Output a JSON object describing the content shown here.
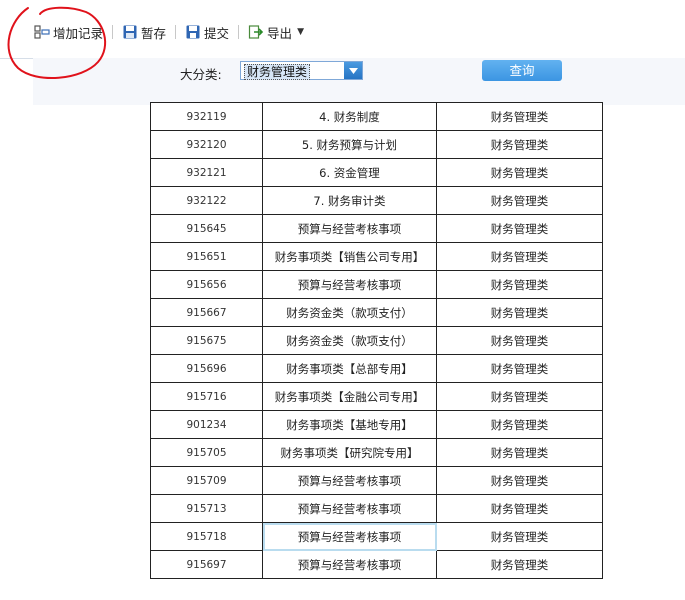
{
  "toolbar": {
    "add_record": "增加记录",
    "save_draft": "暂存",
    "submit": "提交",
    "export": "导出"
  },
  "filter": {
    "label": "大分类:",
    "category_value": "财务管理类",
    "query_button": "查询"
  },
  "table": {
    "rows": [
      {
        "code": "932119",
        "name": "4. 财务制度",
        "category": "财务管理类"
      },
      {
        "code": "932120",
        "name": "5. 财务预算与计划",
        "category": "财务管理类"
      },
      {
        "code": "932121",
        "name": "6. 资金管理",
        "category": "财务管理类"
      },
      {
        "code": "932122",
        "name": "7. 财务审计类",
        "category": "财务管理类"
      },
      {
        "code": "915645",
        "name": "预算与经营考核事项",
        "category": "财务管理类"
      },
      {
        "code": "915651",
        "name": "财务事项类【销售公司专用】",
        "category": "财务管理类"
      },
      {
        "code": "915656",
        "name": "预算与经营考核事项",
        "category": "财务管理类"
      },
      {
        "code": "915667",
        "name": "财务资金类（款项支付）",
        "category": "财务管理类"
      },
      {
        "code": "915675",
        "name": "财务资金类（款项支付）",
        "category": "财务管理类"
      },
      {
        "code": "915696",
        "name": "财务事项类【总部专用】",
        "category": "财务管理类"
      },
      {
        "code": "915716",
        "name": "财务事项类【金融公司专用】",
        "category": "财务管理类"
      },
      {
        "code": "901234",
        "name": "财务事项类【基地专用】",
        "category": "财务管理类"
      },
      {
        "code": "915705",
        "name": "财务事项类【研究院专用】",
        "category": "财务管理类"
      },
      {
        "code": "915709",
        "name": "预算与经营考核事项",
        "category": "财务管理类"
      },
      {
        "code": "915713",
        "name": "预算与经营考核事项",
        "category": "财务管理类"
      },
      {
        "code": "915718",
        "name": "预算与经营考核事项",
        "category": "财务管理类"
      },
      {
        "code": "915697",
        "name": "预算与经营考核事项",
        "category": "财务管理类"
      }
    ]
  },
  "colors": {
    "accent": "#3b95e2",
    "annotation": "#e0121b",
    "selected_cell": "#b9dcef"
  },
  "icons": [
    "add-record-icon",
    "save-icon",
    "submit-icon",
    "export-icon",
    "dropdown-arrow-icon"
  ]
}
